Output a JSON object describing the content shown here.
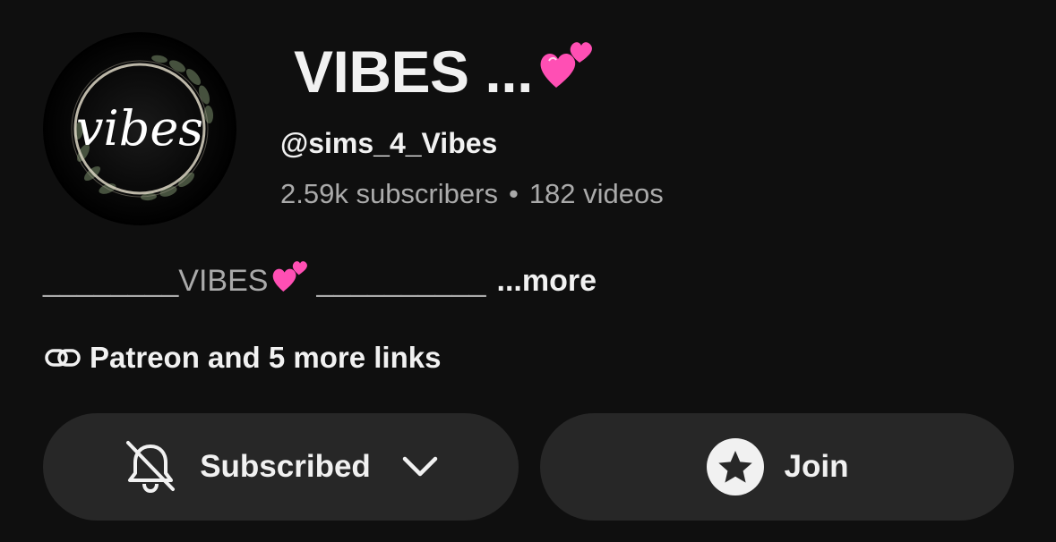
{
  "channel": {
    "name": "VIBES ...",
    "handle": "@sims_4_Vibes",
    "subscribers": "2.59k subscribers",
    "separator": "•",
    "videos": "182 videos",
    "avatar_text": "vibes"
  },
  "description": {
    "prefix": "________VIBES",
    "suffix": "__________",
    "more_label": "...more"
  },
  "links": {
    "label": "Patreon and 5 more links",
    "icon": "link-icon"
  },
  "buttons": {
    "subscribed_label": "Subscribed",
    "join_label": "Join"
  },
  "icons": {
    "heart": "two-hearts-emoji",
    "bell": "bell-off-icon",
    "chevron": "chevron-down-icon",
    "star": "star-icon"
  },
  "colors": {
    "background": "#0f0f0f",
    "button_background": "#272727",
    "primary_text": "#f1f1f1",
    "secondary_text": "#aaaaaa",
    "heart_pink": "#ff4fb4"
  }
}
